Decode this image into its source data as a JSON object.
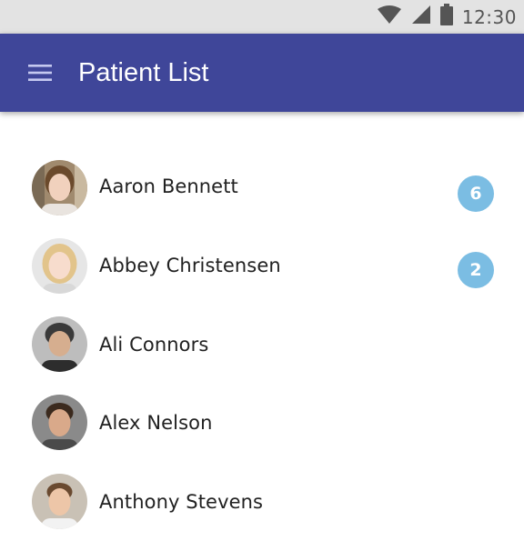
{
  "status_bar": {
    "time": "12:30",
    "icons": [
      "wifi-icon",
      "cellular-signal-icon",
      "battery-icon"
    ]
  },
  "app_bar": {
    "title": "Patient List",
    "menu_icon": "hamburger-menu-icon",
    "background_color": "#3f4699"
  },
  "badge_color": "#7bbde3",
  "patients": [
    {
      "name": "Aaron Bennett",
      "badge": "6",
      "avatar": "avatar-photo"
    },
    {
      "name": "Abbey Christensen",
      "badge": "2",
      "avatar": "avatar-photo"
    },
    {
      "name": "Ali Connors",
      "avatar": "avatar-photo"
    },
    {
      "name": "Alex Nelson",
      "avatar": "avatar-photo"
    },
    {
      "name": "Anthony Stevens",
      "avatar": "avatar-photo"
    }
  ]
}
